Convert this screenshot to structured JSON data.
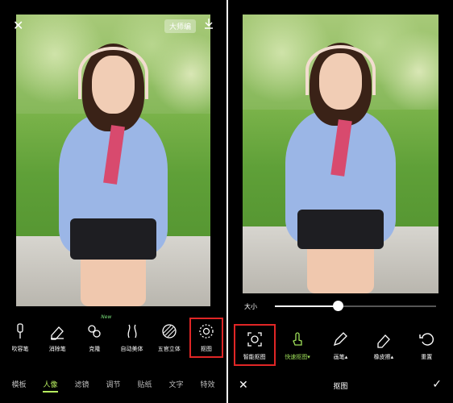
{
  "left": {
    "top": {
      "close_symbol": "✕",
      "export_tag": "大师编"
    },
    "tools": [
      {
        "label": "吹容笔",
        "icon": "brush-icon"
      },
      {
        "label": "消除笔",
        "icon": "eraser-icon"
      },
      {
        "label": "克隆",
        "icon": "clone-icon",
        "badge": "New"
      },
      {
        "label": "自动美体",
        "icon": "body-shape-icon"
      },
      {
        "label": "五官立体",
        "icon": "face-3d-icon"
      },
      {
        "label": "抠图",
        "icon": "cutout-icon"
      }
    ],
    "tabs": [
      "模板",
      "人像",
      "滤镜",
      "调节",
      "贴纸",
      "文字",
      "特效"
    ],
    "active_tab": "人像"
  },
  "right": {
    "size_label": "大小",
    "slider_value": 0.39,
    "tools": [
      {
        "label": "智能抠图",
        "icon": "smart-cutout-icon"
      },
      {
        "label": "快速抠图▾",
        "icon": "quick-select-icon"
      },
      {
        "label": "画笔▴",
        "icon": "pen-icon"
      },
      {
        "label": "橡皮擦▴",
        "icon": "eraser-icon"
      },
      {
        "label": "重置",
        "icon": "reset-icon"
      }
    ],
    "bottom": {
      "cancel": "✕",
      "title": "抠图",
      "confirm": "✓"
    }
  },
  "colors": {
    "accent_green": "#b6ec5f",
    "highlight_red": "#e02626"
  }
}
